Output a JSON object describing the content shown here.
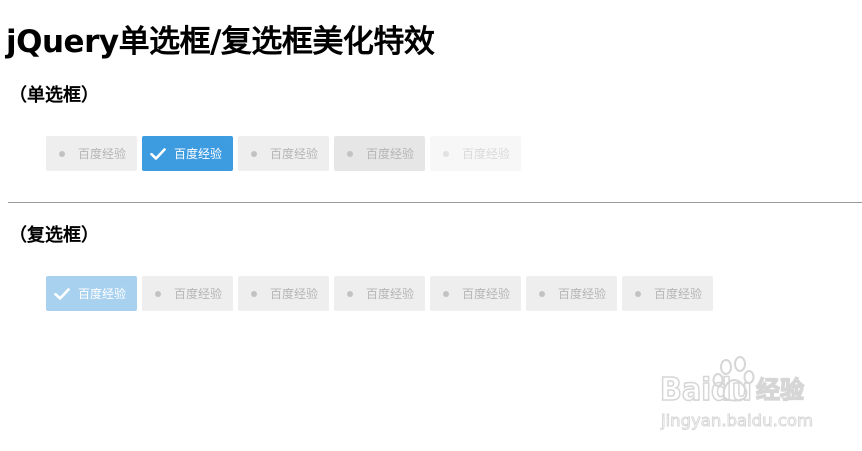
{
  "page": {
    "title": "jQuery单选框/复选框美化特效"
  },
  "radio_section": {
    "heading": "（单选框）",
    "options": [
      {
        "label": "百度经验",
        "state": "normal"
      },
      {
        "label": "百度经验",
        "state": "selected"
      },
      {
        "label": "百度经验",
        "state": "normal"
      },
      {
        "label": "百度经验",
        "state": "hovered"
      },
      {
        "label": "百度经验",
        "state": "disabled"
      }
    ]
  },
  "checkbox_section": {
    "heading": "（复选框）",
    "options": [
      {
        "label": "百度经验",
        "state": "selected-disabled"
      },
      {
        "label": "百度经验",
        "state": "normal"
      },
      {
        "label": "百度经验",
        "state": "normal"
      },
      {
        "label": "百度经验",
        "state": "normal"
      },
      {
        "label": "百度经验",
        "state": "normal"
      },
      {
        "label": "百度经验",
        "state": "normal"
      },
      {
        "label": "百度经验",
        "state": "normal"
      }
    ]
  },
  "watermark": {
    "brand": "Baidu",
    "suffix": "经验",
    "url": "jingyan.baidu.com"
  },
  "colors": {
    "selected": "#3d9be0",
    "selected_disabled": "#a8d1f0",
    "option_bg": "#eeeeee",
    "option_text": "#b5b5b5"
  }
}
